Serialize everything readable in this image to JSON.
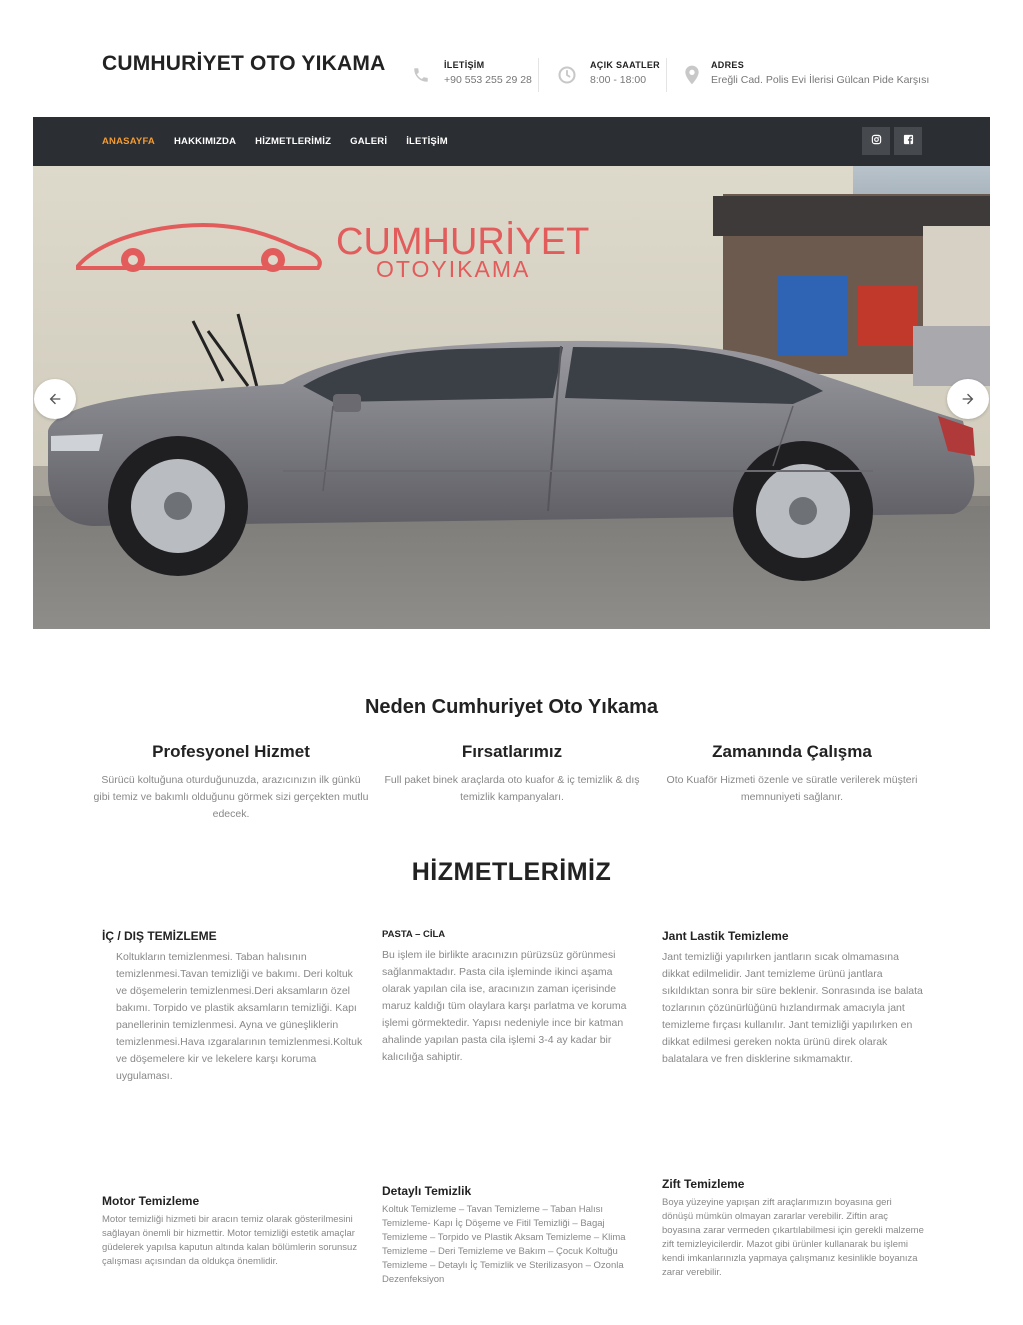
{
  "header": {
    "brand": "CUMHURİYET OTO YIKAMA",
    "contact": {
      "label": "İLETİŞİM",
      "value": "+90 553 255 29 28",
      "icon": "phone-icon"
    },
    "hours": {
      "label": "AÇIK SAATLER",
      "value": "8:00 - 18:00",
      "icon": "clock-icon"
    },
    "address": {
      "label": "ADRES",
      "value": "Ereğli Cad. Polis Evi İlerisi Gülcan Pide Karşısı",
      "icon": "location-pin-icon"
    }
  },
  "nav": {
    "items": [
      "ANASAYFA",
      "HAKKIMIZDA",
      "HİZMETLERİMİZ",
      "GALERİ",
      "İLETİŞİM"
    ],
    "active_color": "#f39c33",
    "bar_color": "#2b2e33",
    "social": [
      "instagram-icon",
      "facebook-icon"
    ]
  },
  "hero": {
    "sign_line1": "CUMHURİYET",
    "sign_line2": "OTOYIKAMA",
    "sign_color": "#e25c5c",
    "prev_icon": "arrow-left-icon",
    "next_icon": "arrow-right-icon"
  },
  "why": {
    "title": "Neden Cumhuriyet Oto Yıkama",
    "features": [
      {
        "title": "Profesyonel Hizmet",
        "text": "Sürücü koltuğuna oturduğunuzda, arazıcınızın ilk günkü gibi temiz ve bakımlı olduğunu görmek sizi gerçekten mutlu edecek."
      },
      {
        "title": "Fırsatlarımız",
        "text": "Full paket binek araçlarda oto kuafor & iç temizlik & dış temizlik kampanyaları."
      },
      {
        "title": "Zamanında Çalışma",
        "text": "Oto Kuaför Hizmeti özenle ve süratle verilerek müşteri memnuniyeti sağlanır."
      }
    ]
  },
  "services": {
    "title": "HİZMETLERİMİZ",
    "items": [
      {
        "title": "İÇ / DIŞ TEMİZLEME",
        "text": "Koltukların temizlenmesi. Taban halısının temizlenmesi.Tavan temizliği ve bakımı. Deri koltuk ve döşemelerin temizlenmesi.Deri aksamların özel bakımı. Torpido ve plastik aksamların temizliği. Kapı panellerinin temizlenmesi. Ayna ve güneşliklerin temizlenmesi.Hava ızgaralarının temizlenmesi.Koltuk ve döşemelere kir ve lekelere karşı koruma uygulaması."
      },
      {
        "title": "PASTA – CİLA",
        "text": "Bu işlem ile birlikte aracınızın pürüzsüz görünmesi sağlanmaktadır. Pasta cila işleminde ikinci aşama olarak yapılan cila ise, aracınızın zaman içerisinde maruz kaldığı tüm olaylara karşı parlatma ve koruma işlemi görmektedir. Yapısı nedeniyle ince bir katman ahalinde yapılan pasta cila işlemi 3-4 ay kadar bir kalıcılığa sahiptir."
      },
      {
        "title": "Jant Lastik Temizleme",
        "text": "Jant temizliği yapılırken jantların sıcak olmamasına dikkat edilmelidir. Jant temizleme ürünü jantlara sıkıldıktan sonra bir süre beklenir. Sonrasında ise balata tozlarının çözünürlüğünü hızlandırmak amacıyla jant temizleme fırçası kullanılır. Jant temizliği yapılırken en dikkat edilmesi gereken nokta ürünü direk olarak balatalara ve fren disklerine sıkmamaktır."
      },
      {
        "title": "Motor Temizleme",
        "text": "Motor temizliği hizmeti bir aracın temiz olarak gösterilmesini sağlayan önemli bir hizmettir. Motor temizliği estetik amaçlar güdelerek yapılsa kaputun altında kalan bölümlerin sorunsuz çalışması açısından da oldukça önemlidir."
      },
      {
        "title": "Detaylı Temizlik",
        "text": "Koltuk Temizleme – Tavan Temizleme – Taban Halısı Temizleme- Kapı İç Döşeme ve Fitil Temizliği – Bagaj Temizleme – Torpido ve Plastik Aksam Temizleme – Klima Temizleme – Deri Temizleme ve Bakım – Çocuk Koltuğu Temizleme – Detaylı İç Temizlik ve Sterilizasyon – Ozonla Dezenfeksiyon"
      },
      {
        "title": "Zift Temizleme",
        "text": "Boya yüzeyine yapışan zift araçlarımızın boyasına geri dönüşü mümkün olmayan zararlar verebilir. Ziftin araç boyasına zarar vermeden çıkartılabilmesi için gerekli malzeme zift temizleyicilerdir. Mazot gibi ürünler kullanarak bu işlemi kendi imkanlarınızla yapmaya çalışmanız kesinlikle boyanıza zarar verebilir."
      }
    ]
  }
}
